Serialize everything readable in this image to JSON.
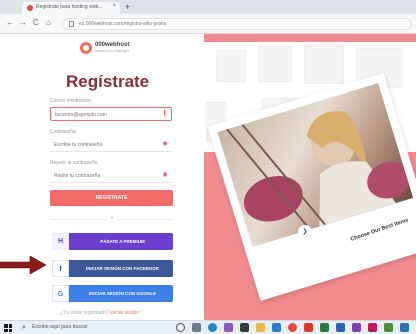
{
  "browser": {
    "tab_title": "Registrate para hosting web... ",
    "tab_close": "×",
    "new_tab": "+",
    "nav_back": "←",
    "nav_forward": "→",
    "nav_reload": "C",
    "nav_home": "⌂",
    "url": "es.000webhost.com/registro-sitio-gratis"
  },
  "signup": {
    "logo_text": "000webhost",
    "logo_tagline": "powered by Hostinger",
    "title": "Regístrate",
    "email_label": "Correo electrónico",
    "email_placeholder": "tucorreo@ejemplo.com",
    "password_label": "Contraseña",
    "password_placeholder": "Escribe tu contraseña",
    "repeat_label": "Repetir la contraseña",
    "repeat_placeholder": "Repite tu contraseña",
    "register_button": "REGISTRATE",
    "divider_text": "o",
    "premium_button": "PÁSATE A PREMIUM",
    "facebook_button": "INICIAR SESIÓN CON FACEBOOK",
    "google_button": "INICIAR SESIÓN CON GOOGLE",
    "login_prompt": "¿Ya estás registrado?",
    "login_link": "Iniciar sesión"
  },
  "showcase": {
    "hero_caption": "Choose Our Best Items",
    "play_symbol": "❯"
  },
  "taskbar": {
    "search_text": "Escribe aquí para buscar",
    "search_icon": "⌕"
  },
  "colors": {
    "brand_title": "#8a2e3c",
    "primary_button": "#f06a67",
    "premium": "#6a3fd0",
    "facebook": "#3c5899",
    "google": "#3d7fe6",
    "arrow": "#8b1a1a",
    "showcase_bg": "#f28b8f"
  }
}
